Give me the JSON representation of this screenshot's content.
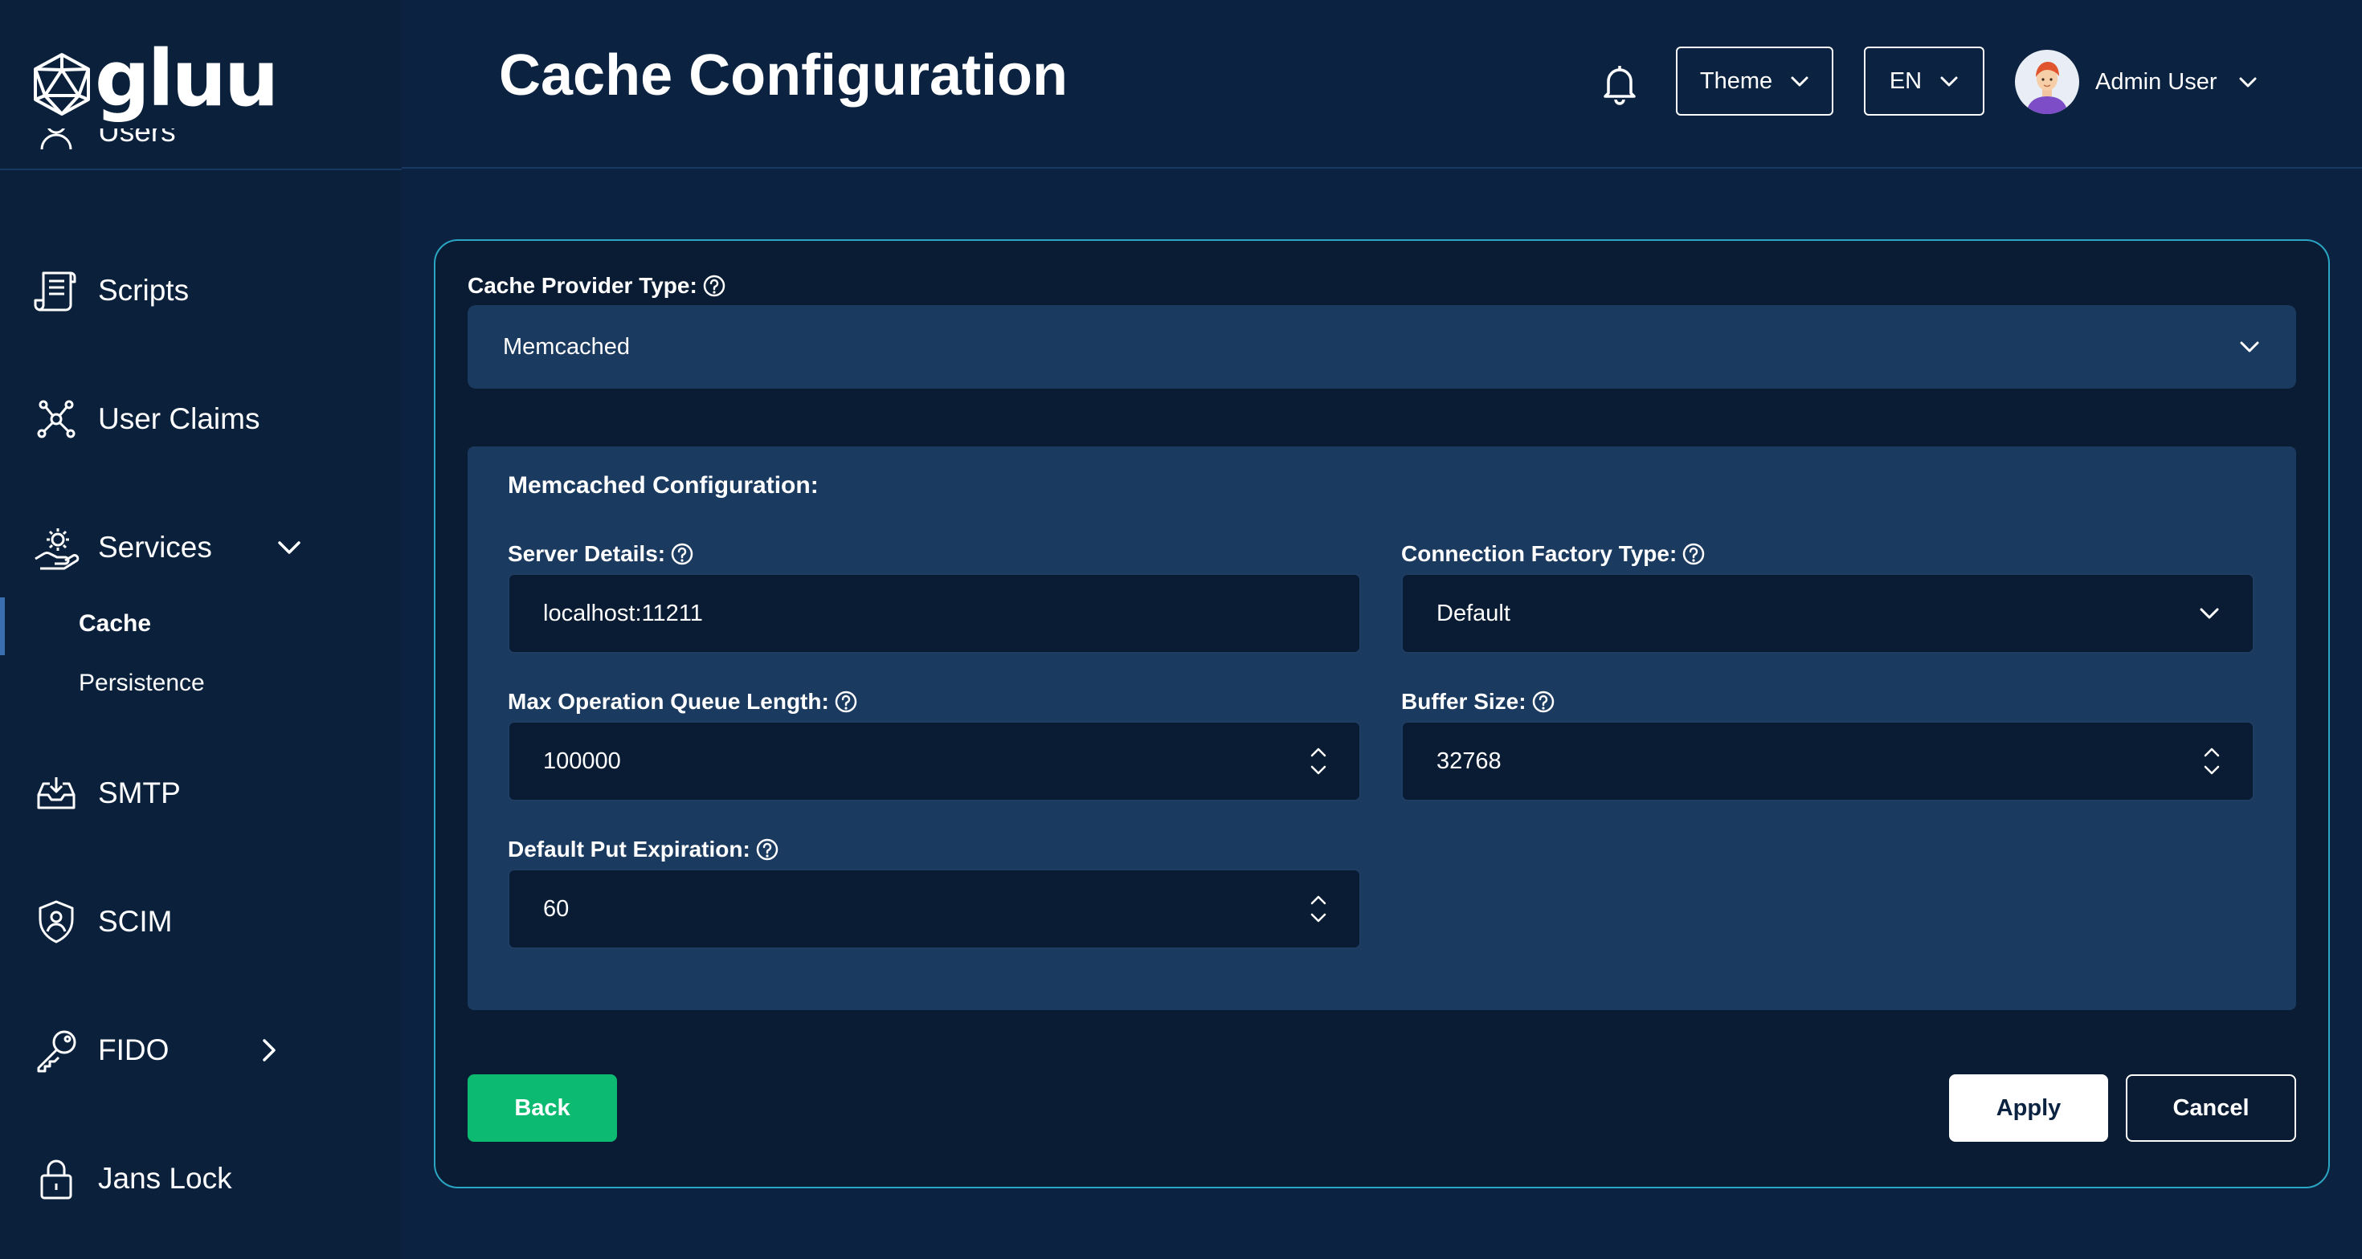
{
  "app": {
    "brand": "gluu"
  },
  "header": {
    "title": "Cache Configuration",
    "theme_label": "Theme",
    "language_label": "EN",
    "user_name": "Admin User"
  },
  "sidebar": {
    "partial_item": "Users",
    "items": [
      {
        "label": "Scripts",
        "icon": "script-icon"
      },
      {
        "label": "User Claims",
        "icon": "claims-icon"
      },
      {
        "label": "Services",
        "icon": "services-icon",
        "expanded": true
      },
      {
        "label": "SMTP",
        "icon": "inbox-icon"
      },
      {
        "label": "SCIM",
        "icon": "user-shield-icon"
      },
      {
        "label": "FIDO",
        "icon": "key-icon"
      },
      {
        "label": "Jans Lock",
        "icon": "lock-icon"
      }
    ],
    "sub_items": [
      {
        "label": "Cache",
        "active": true
      },
      {
        "label": "Persistence",
        "active": false
      }
    ]
  },
  "form": {
    "provider_label": "Cache Provider Type:",
    "provider_value": "Memcached",
    "section_title": "Memcached Configuration:",
    "server_details": {
      "label": "Server Details:",
      "value": "localhost:11211"
    },
    "connection_factory": {
      "label": "Connection Factory Type:",
      "value": "Default"
    },
    "max_queue": {
      "label": "Max Operation Queue Length:",
      "value": "100000"
    },
    "buffer_size": {
      "label": "Buffer Size:",
      "value": "32768"
    },
    "default_put_expiration": {
      "label": "Default Put Expiration:",
      "value": "60"
    }
  },
  "actions": {
    "back": "Back",
    "apply": "Apply",
    "cancel": "Cancel"
  },
  "colors": {
    "background": "#0b2340",
    "sidebar": "#0a203b",
    "card_border": "#2aa6c4",
    "field_panel": "#1b3a5f",
    "primary_green": "#0dba72"
  }
}
